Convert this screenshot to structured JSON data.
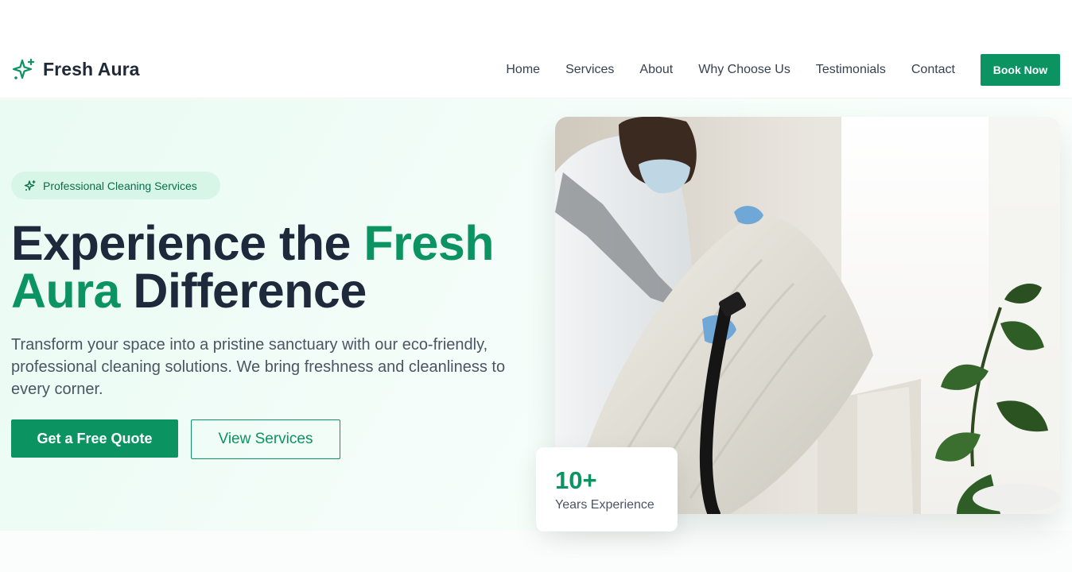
{
  "brand": {
    "name": "Fresh Aura",
    "icon": "sparkles-icon"
  },
  "nav": {
    "items": [
      "Home",
      "Services",
      "About",
      "Why Choose Us",
      "Testimonials",
      "Contact"
    ],
    "cta_label": "Book Now"
  },
  "hero": {
    "badge": {
      "icon": "sparkles-icon",
      "text": "Professional Cleaning Services"
    },
    "headline": {
      "part1": "Experience the ",
      "accent1": "Fresh",
      "accent2": "Aura",
      "part2": " Difference"
    },
    "lead": "Transform your space into a pristine sanctuary with our eco-friendly, professional cleaning solutions. We bring freshness and cleanliness to every corner.",
    "primary_button": "Get a Free Quote",
    "secondary_button": "View Services",
    "stat": {
      "value": "10+",
      "label": "Years Experience"
    }
  },
  "colors": {
    "accent": "#0b9462",
    "heading": "#1e293b",
    "badge_bg": "#d7f6e8",
    "hero_bg": "#e9fbf3"
  }
}
